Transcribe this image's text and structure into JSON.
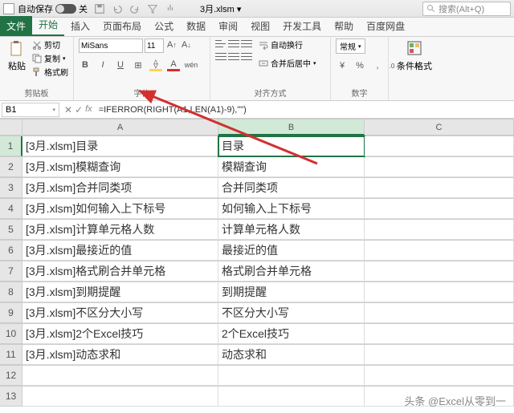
{
  "titlebar": {
    "autosave_label": "自动保存",
    "autosave_state": "关",
    "docname": "3月.xlsm ▾",
    "search_placeholder": "搜索(Alt+Q)"
  },
  "tabs": {
    "file": "文件",
    "items": [
      "开始",
      "插入",
      "页面布局",
      "公式",
      "数据",
      "审阅",
      "视图",
      "开发工具",
      "帮助",
      "百度网盘"
    ],
    "active": 0
  },
  "ribbon": {
    "clipboard": {
      "paste": "粘贴",
      "cut": "剪切",
      "copy": "复制",
      "format_painter": "格式刷",
      "group": "剪贴板"
    },
    "font": {
      "name": "MiSans",
      "size": "11",
      "group": "字体"
    },
    "align": {
      "autowrap": "自动换行",
      "merge": "合并后居中",
      "group": "对齐方式"
    },
    "number": {
      "general": "常规",
      "group": "数字"
    },
    "styles": {
      "cond": "条件格式"
    }
  },
  "formulabar": {
    "namebox": "B1",
    "formula": "=IFERROR(RIGHT(A1,LEN(A1)-9),\"\")"
  },
  "grid": {
    "columns": [
      "A",
      "B",
      "C"
    ],
    "rows": [
      {
        "r": "1",
        "A": "[3月.xlsm]目录",
        "B": "目录"
      },
      {
        "r": "2",
        "A": "[3月.xlsm]模糊查询",
        "B": "模糊查询"
      },
      {
        "r": "3",
        "A": "[3月.xlsm]合并同类项",
        "B": "合并同类项"
      },
      {
        "r": "4",
        "A": "[3月.xlsm]如何输入上下标号",
        "B": "如何输入上下标号"
      },
      {
        "r": "5",
        "A": "[3月.xlsm]计算单元格人数",
        "B": "计算单元格人数"
      },
      {
        "r": "6",
        "A": "[3月.xlsm]最接近的值",
        "B": "最接近的值"
      },
      {
        "r": "7",
        "A": "[3月.xlsm]格式刷合并单元格",
        "B": "格式刷合并单元格"
      },
      {
        "r": "8",
        "A": "[3月.xlsm]到期提醒",
        "B": "到期提醒"
      },
      {
        "r": "9",
        "A": "[3月.xlsm]不区分大小写",
        "B": "不区分大小写"
      },
      {
        "r": "10",
        "A": "[3月.xlsm]2个Excel技巧",
        "B": "2个Excel技巧"
      },
      {
        "r": "11",
        "A": "[3月.xlsm]动态求和",
        "B": "动态求和"
      },
      {
        "r": "12",
        "A": "",
        "B": ""
      },
      {
        "r": "13",
        "A": "",
        "B": ""
      }
    ]
  },
  "watermark": "头条 @Excel从零到一"
}
